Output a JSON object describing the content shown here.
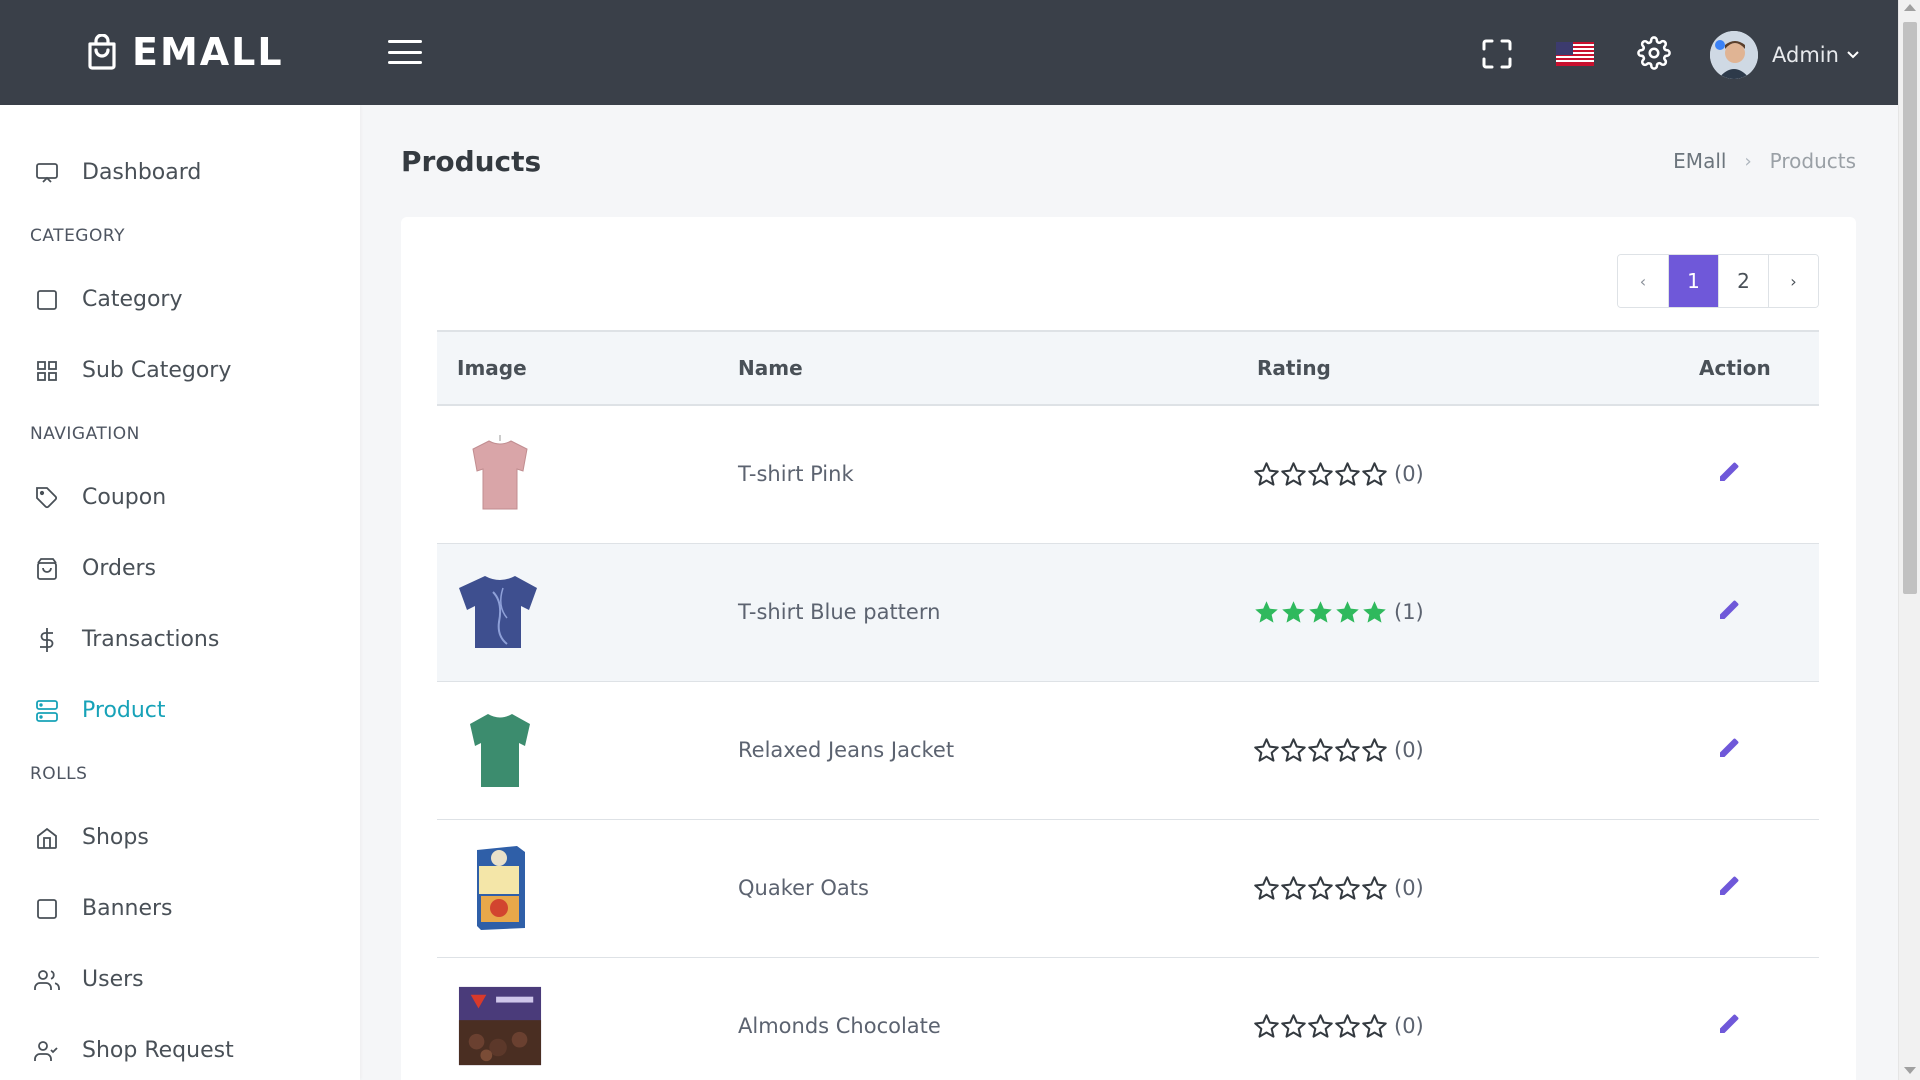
{
  "app": {
    "brand": "EMALL"
  },
  "topbar": {
    "icons": [
      "hamburger-icon",
      "fullscreen-icon",
      "us-flag-icon",
      "settings-icon"
    ],
    "user_label": "Admin"
  },
  "sidebar": {
    "items": [
      {
        "type": "item",
        "label": "Dashboard",
        "icon": "monitor-icon"
      },
      {
        "type": "section",
        "label": "CATEGORY"
      },
      {
        "type": "item",
        "label": "Category",
        "icon": "square-icon"
      },
      {
        "type": "item",
        "label": "Sub Category",
        "icon": "grid-icon"
      },
      {
        "type": "section",
        "label": "NAVIGATION"
      },
      {
        "type": "item",
        "label": "Coupon",
        "icon": "tag-icon"
      },
      {
        "type": "item",
        "label": "Orders",
        "icon": "bag-icon"
      },
      {
        "type": "item",
        "label": "Transactions",
        "icon": "dollar-icon"
      },
      {
        "type": "item",
        "label": "Product",
        "icon": "server-icon",
        "active": true
      },
      {
        "type": "section",
        "label": "ROLLS"
      },
      {
        "type": "item",
        "label": "Shops",
        "icon": "home-icon"
      },
      {
        "type": "item",
        "label": "Banners",
        "icon": "square-icon"
      },
      {
        "type": "item",
        "label": "Users",
        "icon": "users-icon"
      },
      {
        "type": "item",
        "label": "Shop Request",
        "icon": "user-check-icon"
      }
    ],
    "active_color": "#17a2b8"
  },
  "page": {
    "title": "Products",
    "breadcrumb": {
      "root": "EMall",
      "current": "Products"
    }
  },
  "pagination": {
    "prev": "‹",
    "pages": [
      "1",
      "2"
    ],
    "current": "1",
    "next": "›",
    "active_color": "#6f58d9"
  },
  "table": {
    "columns": [
      "Image",
      "Name",
      "Rating",
      "Action"
    ],
    "rows": [
      {
        "name": "T-shirt Pink",
        "rating": 0,
        "count": "(0)",
        "image": "pink-tshirt-image"
      },
      {
        "name": "T-shirt Blue pattern",
        "rating": 5,
        "count": "(1)",
        "image": "blue-tshirt-image"
      },
      {
        "name": "Relaxed Jeans Jacket",
        "rating": 0,
        "count": "(0)",
        "image": "green-tshirt-image"
      },
      {
        "name": "Quaker Oats",
        "rating": 0,
        "count": "(0)",
        "image": "oats-box-image"
      },
      {
        "name": "Almonds Chocolate",
        "rating": 0,
        "count": "(0)",
        "image": "chocolate-box-image"
      }
    ],
    "star_filled_color": "#2fb95d",
    "edit_color": "#6f58d9"
  }
}
